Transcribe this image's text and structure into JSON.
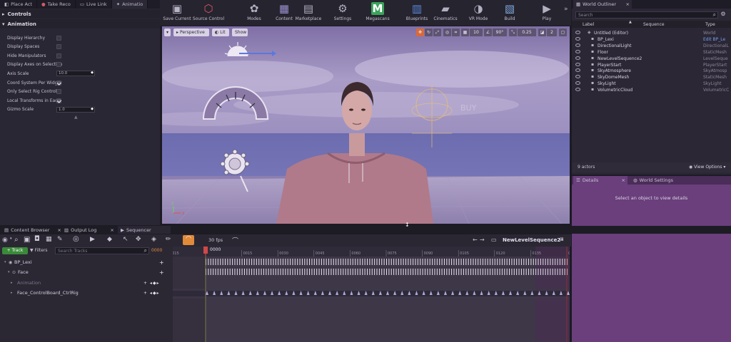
{
  "left_panel": {
    "tabs": [
      {
        "label": "Place Act",
        "icon": "place-actors-icon"
      },
      {
        "label": "Take Reco",
        "icon": "record-icon"
      },
      {
        "label": "Live Link",
        "icon": "live-link-icon"
      },
      {
        "label": "Animatio",
        "icon": "animation-icon"
      }
    ],
    "sections": {
      "controls": "Controls",
      "animation": "Animation"
    },
    "properties": [
      {
        "label": "Display Hierarchy",
        "kind": "check",
        "checked": false
      },
      {
        "label": "Display Spaces",
        "kind": "check",
        "checked": false
      },
      {
        "label": "Hide Manipulators",
        "kind": "check",
        "checked": false
      },
      {
        "label": "Display Axes on Selection",
        "kind": "check",
        "checked": false
      },
      {
        "label": "Axis Scale",
        "kind": "number",
        "value": "10.0"
      },
      {
        "label": "Coord System Per Widget",
        "kind": "check",
        "checked": true
      },
      {
        "label": "Only Select Rig Controls",
        "kind": "check",
        "checked": false
      },
      {
        "label": "Local Transforms in Each",
        "kind": "check",
        "checked": true
      },
      {
        "label": "Gizmo Scale",
        "kind": "number",
        "value": "1.0"
      }
    ]
  },
  "toolbar": {
    "items": [
      {
        "label": "Save Current",
        "icon": "save-icon"
      },
      {
        "label": "Source Control",
        "icon": "source-control-icon"
      },
      {
        "label": "Modes",
        "icon": "modes-icon"
      },
      {
        "label": "Content",
        "icon": "content-icon"
      },
      {
        "label": "Marketplace",
        "icon": "marketplace-icon"
      },
      {
        "label": "Settings",
        "icon": "settings-icon"
      },
      {
        "label": "Megascans",
        "icon": "megascans-icon"
      },
      {
        "label": "Blueprints",
        "icon": "blueprints-icon"
      },
      {
        "label": "Cinematics",
        "icon": "cinematics-icon"
      },
      {
        "label": "VR Mode",
        "icon": "vr-mode-icon"
      },
      {
        "label": "Build",
        "icon": "build-icon"
      },
      {
        "label": "Play",
        "icon": "play-icon"
      }
    ]
  },
  "viewport": {
    "perspective": "Perspective",
    "lit": "Lit",
    "show": "Show",
    "snap_values": {
      "grid": "10",
      "rotation": "90°",
      "scale": "0.25",
      "camera": "2"
    },
    "axis_labels": {
      "z": "z",
      "x": "x",
      "y": "y"
    }
  },
  "outliner": {
    "tab": "World Outliner",
    "search_placeholder": "Search",
    "columns": {
      "label": "Label",
      "sequence": "Sequence",
      "type": "Type"
    },
    "rows": [
      {
        "name": "Untitled (Editor)",
        "type": "World",
        "indent": 0
      },
      {
        "name": "BP_Lexi",
        "type": "Edit BP_Le",
        "indent": 1,
        "link": true
      },
      {
        "name": "DirectionalLight",
        "type": "DirectionalL",
        "indent": 1
      },
      {
        "name": "Floor",
        "type": "StaticMesh",
        "indent": 1
      },
      {
        "name": "NewLevelSequence2",
        "type": "LevelSeque",
        "indent": 1
      },
      {
        "name": "PlayerStart",
        "type": "PlayerStart",
        "indent": 1
      },
      {
        "name": "SkyAtmosphere",
        "type": "SkyAtmosp",
        "indent": 1
      },
      {
        "name": "SkyDomeMesh",
        "type": "StaticMesh",
        "indent": 1
      },
      {
        "name": "SkyLight",
        "type": "SkyLight",
        "indent": 1
      },
      {
        "name": "VolumetricCloud",
        "type": "VolumetricC",
        "indent": 1
      }
    ],
    "actor_count": "9 actors",
    "view_options": "View Options"
  },
  "details": {
    "tabs": [
      {
        "label": "Details",
        "icon": "details-icon"
      },
      {
        "label": "World Settings",
        "icon": "world-settings-icon"
      }
    ],
    "empty_text": "Select an object to view details"
  },
  "bottom_tabs": [
    {
      "label": "Content Browser",
      "icon": "content-browser-icon"
    },
    {
      "label": "Output Log",
      "icon": "output-log-icon"
    },
    {
      "label": "Sequencer",
      "icon": "sequencer-icon"
    }
  ],
  "sequencer": {
    "fps": "30 fps",
    "sequence_name": "NewLevelSequence2*",
    "add_track": "+ Track",
    "filters": "Filters",
    "search_placeholder": "Search Tracks",
    "current_frame": "0000",
    "playhead_frame": "0000",
    "tracks": [
      {
        "label": "BP_Lexi",
        "indent": 0
      },
      {
        "label": "Face",
        "indent": 1
      },
      {
        "label": "Animation",
        "indent": 2,
        "dim": true
      },
      {
        "label": "Face_ControlBoard_CtrlRig",
        "indent": 2
      }
    ],
    "ruler": [
      "-015",
      "0015",
      "0030",
      "0045",
      "0060",
      "0075",
      "0090",
      "0105",
      "0120",
      "0135",
      "0150"
    ]
  },
  "colors": {
    "overlay": "#6a3f7c",
    "accent": "#c9a0e0",
    "track_green": "#3a8a3a"
  }
}
